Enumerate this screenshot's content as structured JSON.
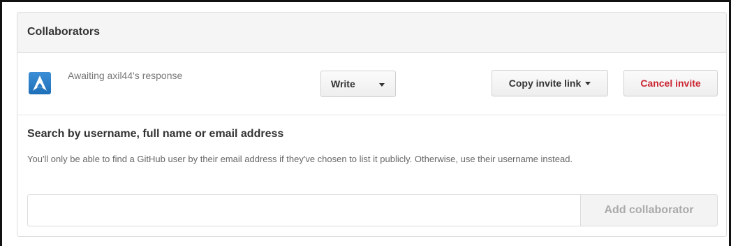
{
  "panel": {
    "title": "Collaborators"
  },
  "collaborator": {
    "status_text": "Awaiting axil44's response",
    "avatar_icon": "arch-linux-logo-avatar",
    "permission_label": "Write",
    "copy_invite_label": "Copy invite link",
    "cancel_invite_label": "Cancel invite"
  },
  "search": {
    "title": "Search by username, full name or email address",
    "note": "You'll only be able to find a GitHub user by their email address if they've chosen to list it publicly. Otherwise, use their username instead.",
    "input_value": "",
    "add_button_label": "Add collaborator"
  },
  "colors": {
    "cancel_text": "#cb2431",
    "avatar_blue": "#1d6fb8"
  }
}
